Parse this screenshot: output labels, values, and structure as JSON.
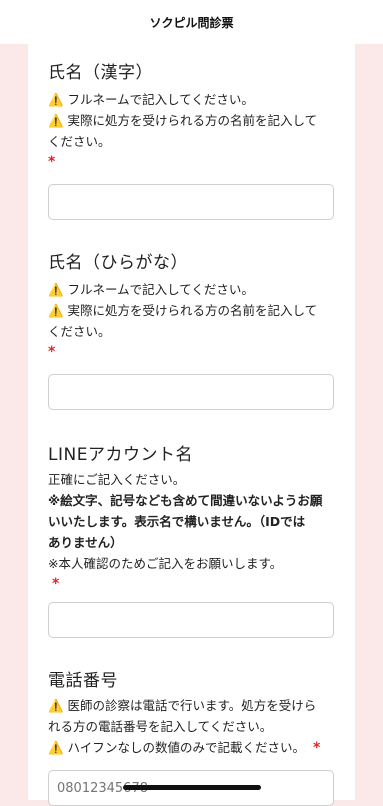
{
  "header": {
    "title": "ソクピル問診票"
  },
  "fields": [
    {
      "label": "氏名（漢字）",
      "notes": [
        "⚠️ フルネームで記入してください。",
        "⚠️ 実際に処方を受けられる方の名前を記入して",
        "ください。"
      ],
      "required": "*",
      "value": ""
    },
    {
      "label": "氏名（ひらがな）",
      "notes": [
        "⚠️ フルネームで記入してください。",
        "⚠️ 実際に処方を受けられる方の名前を記入して",
        "ください。"
      ],
      "required": "*",
      "value": ""
    },
    {
      "label": "LINEアカウント名",
      "notes": [
        "正確にご記入ください。",
        "※絵文字、記号なども含めて間違いないようお願",
        "いいたします。表示名で構いません。（IDでは",
        "ありません）",
        "※本人確認のためご記入をお願いします。"
      ],
      "required": "*",
      "value": ""
    },
    {
      "label": "電話番号",
      "notes": [
        "⚠️ 医師の診察は電話で行います。処方を受けら",
        "れる方の電話番号を記入してください。",
        "⚠️ ハイフンなしの数値のみで記載ください。"
      ],
      "required": "*",
      "placeholder": "08012345678"
    }
  ]
}
